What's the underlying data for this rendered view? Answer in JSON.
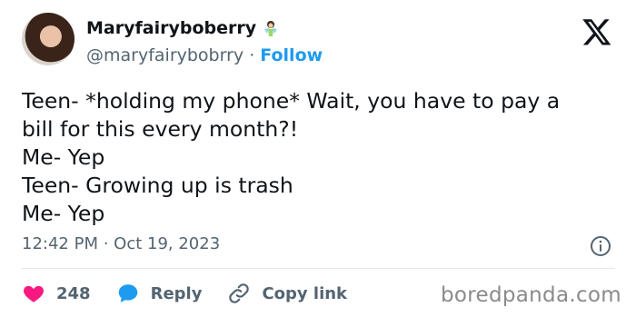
{
  "author": {
    "name": "Maryfairyboberry",
    "handle": "@maryfairybobrry",
    "separator": " · ",
    "follow_label": "Follow"
  },
  "tweet": {
    "lines": [
      "Teen- *holding my phone* Wait, you have to pay a",
      "bill for this every month?!",
      "Me- Yep",
      "Teen- Growing up is trash",
      "Me- Yep"
    ],
    "timestamp": "12:42 PM · Oct 19, 2023"
  },
  "actions": {
    "like_count": "248",
    "reply_label": "Reply",
    "copy_link_label": "Copy link"
  },
  "watermark": "boredpanda.com",
  "colors": {
    "accent": "#1d9bf0",
    "like": "#f91880",
    "muted": "#536471"
  },
  "icons": [
    "fairy-badge-icon",
    "x-logo-icon",
    "info-icon",
    "heart-icon",
    "reply-bubble-icon",
    "link-icon"
  ]
}
